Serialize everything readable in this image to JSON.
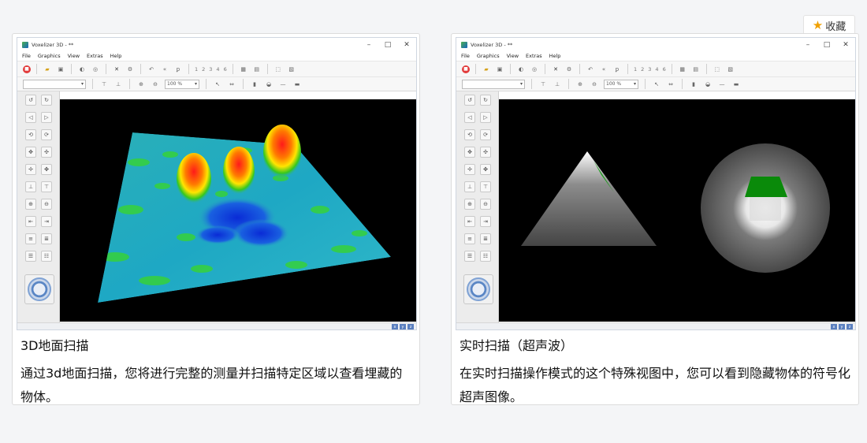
{
  "favorite": {
    "icon": "star-icon",
    "label": "收藏"
  },
  "app": {
    "window_title": "Voxelizer 3D - **",
    "menu": [
      "File",
      "Graphics",
      "View",
      "Extras",
      "Help"
    ],
    "toolbar_numbers": [
      "1",
      "2",
      "3",
      "4",
      "6"
    ],
    "zoom_value": "100 %",
    "axis_buttons": [
      "x",
      "y",
      "z"
    ]
  },
  "cards": [
    {
      "title": "3D地面扫描",
      "body": "通过3d地面扫描，您将进行完整的测量并扫描特定区域以查看埋藏的物体。"
    },
    {
      "title": "实时扫描（超声波）",
      "body": "在实时扫描操作模式的这个特殊视图中，您可以看到隐藏物体的符号化超声图像。"
    }
  ],
  "colors": {
    "star": "#f0a000",
    "stop_button": "#e23b3b",
    "viewport_bg": "#000000"
  }
}
